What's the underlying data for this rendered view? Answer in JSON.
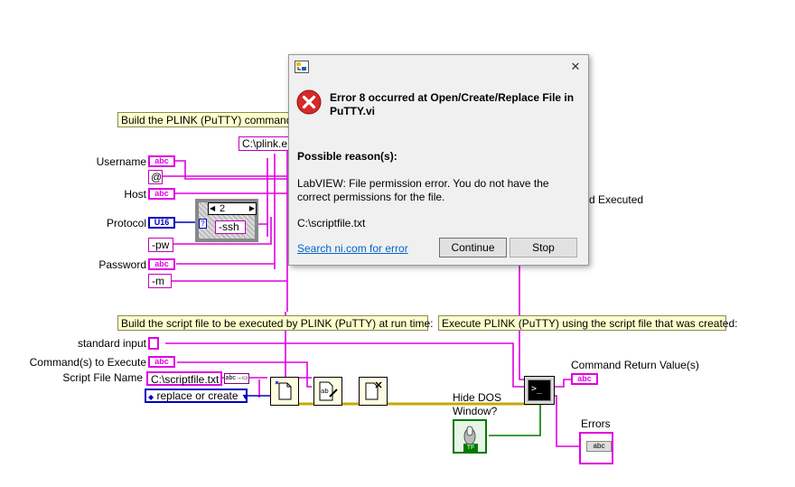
{
  "diagram": {
    "comments": {
      "build_command": "Build the PLINK (PuTTY) command",
      "build_script": "Build the script file to be executed by PLINK (PuTTY) at run time:",
      "execute": "Execute PLINK (PuTTY) using the script file that was created:"
    },
    "labels": {
      "username": "Username",
      "host": "Host",
      "protocol": "Protocol",
      "password": "Password",
      "standard_input": "standard input",
      "commands_to_execute": "Command(s) to Execute",
      "script_file_name": "Script File Name",
      "hide_dos_window": "Hide DOS\nWindow?",
      "command_return_value": "Command Return Value(s)",
      "errors": "Errors",
      "hidden_executed": "d Executed"
    },
    "constants": {
      "plink_path": "C:\\plink.e",
      "at": "@",
      "case_selector": "2",
      "ssh": "-ssh",
      "pw": "-pw",
      "m": "-m",
      "script_file_value": "C:\\scriptfile.txt",
      "file_mode": "replace or create"
    },
    "glyphs": {
      "abc": "abc",
      "u16": "U16",
      "tf": "TF",
      "question": "?"
    }
  },
  "dialog": {
    "title": "",
    "error_title": "Error 8 occurred at Open/Create/Replace File in PuTTY.vi",
    "reasons_heading": "Possible reason(s):",
    "reason_text": "LabVIEW:  File permission error. You do not have the correct permissions for the file.",
    "path": "C:\\scriptfile.txt",
    "search_link": "Search ni.com for error",
    "continue_label": "Continue",
    "stop_label": "Stop",
    "close_glyph": "✕"
  },
  "colors": {
    "string_wire": "#e000e0",
    "numeric_wire": "#0000c0",
    "error_wire": "#c8a800",
    "boolean_wire": "#007a00",
    "error_icon": "#d42a2a",
    "link": "#0066cc"
  }
}
